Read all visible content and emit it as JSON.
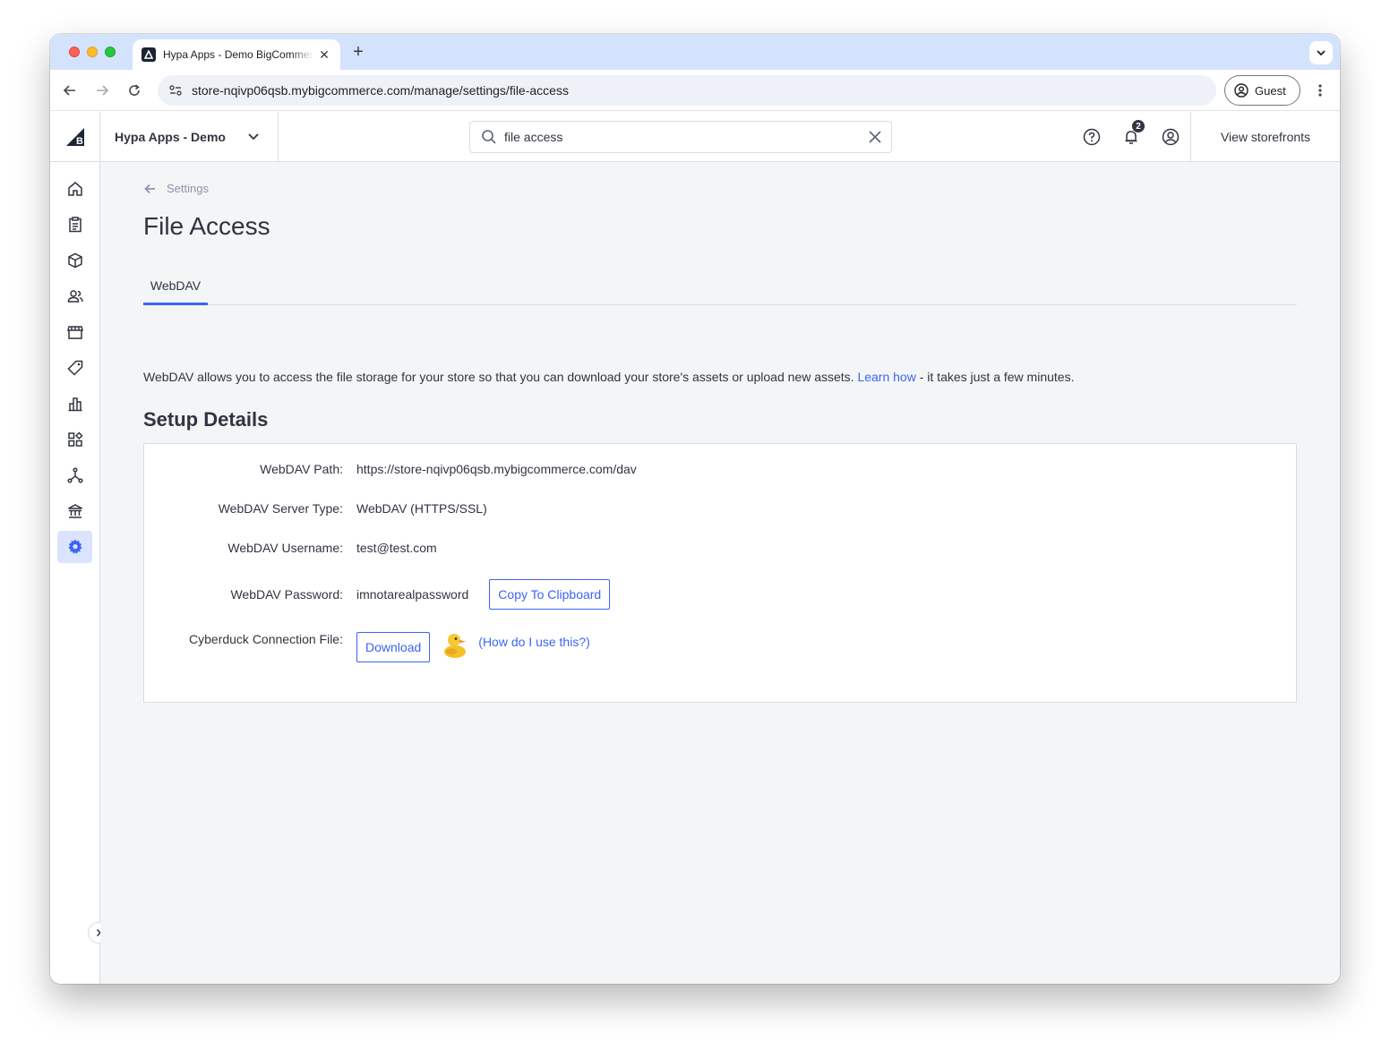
{
  "browser": {
    "tab_title": "Hypa Apps - Demo BigCommerce",
    "url": "store-nqivp06qsb.mybigcommerce.com/manage/settings/file-access",
    "profile_label": "Guest"
  },
  "header": {
    "store_name": "Hypa Apps - Demo",
    "search_value": "file access",
    "notification_count": "2",
    "view_storefronts_label": "View storefronts"
  },
  "page": {
    "breadcrumb": "Settings",
    "title": "File Access",
    "tabs": [
      {
        "label": "WebDAV"
      }
    ],
    "intro_before": "WebDAV allows you to access the file storage for your store so that you can download your store's assets or upload new assets. ",
    "intro_link": "Learn how",
    "intro_after": " - it takes just a few minutes.",
    "section_title": "Setup Details",
    "details": {
      "path_label": "WebDAV Path:",
      "path_value": "https://store-nqivp06qsb.mybigcommerce.com/dav",
      "server_type_label": "WebDAV Server Type:",
      "server_type_value": "WebDAV (HTTPS/SSL)",
      "username_label": "WebDAV Username:",
      "username_value": "test@test.com",
      "password_label": "WebDAV Password:",
      "password_value": "imnotarealpassword",
      "copy_button": "Copy To Clipboard",
      "cyberduck_label": "Cyberduck Connection File:",
      "download_button": "Download",
      "help_open": "(",
      "help_link": "How do I use this?",
      "help_close": ")"
    }
  },
  "colors": {
    "accent": "#3c64f4",
    "text": "#313440",
    "muted": "#8c93ad",
    "border": "#d9dce9",
    "page_bg": "#f4f5f7",
    "sidebar_active": "#dbe3fe"
  },
  "icons": {
    "sidebar": [
      "home-icon",
      "orders-icon",
      "products-icon",
      "customers-icon",
      "storefront-icon",
      "marketing-icon",
      "analytics-icon",
      "apps-icon",
      "channels-icon",
      "finance-icon",
      "settings-icon"
    ]
  }
}
